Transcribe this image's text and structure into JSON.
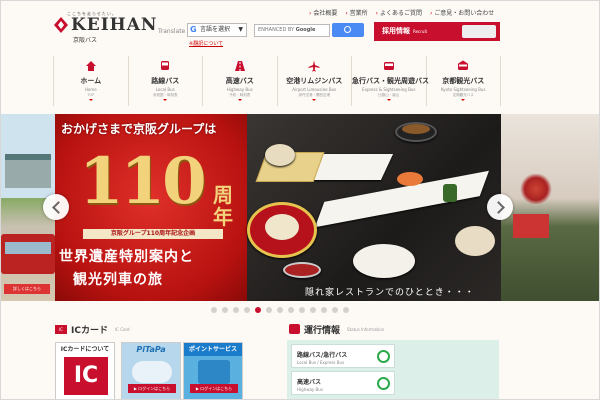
{
  "brand": {
    "kana": "ここちを走らせたい。",
    "name": "KEIHAN",
    "sub": "京阪バス"
  },
  "top_links": [
    "会社概要",
    "営業所",
    "よくあるご質問",
    "ご意見・お問い合わせ"
  ],
  "translate": {
    "label": "Translate",
    "select_value": "言語を選択",
    "note": "※翻訳について"
  },
  "search": {
    "placeholder_enhanced": "ENHANCED BY",
    "placeholder_google": "Google"
  },
  "recruit": {
    "label": "採用情報",
    "sub": "Recruit"
  },
  "nav": [
    {
      "label": "ホーム",
      "en": "Home",
      "small": "TOP",
      "icon": "home-icon"
    },
    {
      "label": "路線バス",
      "en": "Local Bus",
      "small": "系統図・時刻表",
      "icon": "bus-icon"
    },
    {
      "label": "高速バス",
      "en": "Highway Bus",
      "small": "予約・時刻表",
      "icon": "highway-icon"
    },
    {
      "label": "空港リムジンバス",
      "en": "Airport Limousine Bus",
      "small": "伊丹空港・関西空港",
      "icon": "airplane-icon"
    },
    {
      "label": "急行バス・観光周遊バス",
      "en": "Express & Sightseeing Bus",
      "small": "比叡山・嵐山",
      "icon": "express-bus-icon"
    },
    {
      "label": "京都観光バス",
      "en": "Kyoto Sightseeing Bus",
      "small": "定期観光バス",
      "icon": "kyoto-bus-icon"
    }
  ],
  "slider": {
    "left_button": "詳しくはこちら",
    "main_top": "おかげさまで京阪グループは",
    "main_number": "110",
    "main_suffix": "周年",
    "main_band": "京阪グループ110周年記念企画",
    "main_line1": "世界遺産特別案内と",
    "main_line2": "観光列車の旅",
    "food_caption": "隠れ家レストランでのひととき・・・",
    "dot_count": 13,
    "active_dot": 4
  },
  "ic": {
    "title": "ICカード",
    "en": "IC Card",
    "cards": [
      {
        "title": "ICカードについて",
        "big": "IC",
        "button": ""
      },
      {
        "title": "PiTaPa",
        "button": "▶ ログインはこちら"
      },
      {
        "title": "ポイントサービス",
        "button": "▶ ログインはこちら"
      }
    ]
  },
  "status": {
    "title": "運行情報",
    "en": "Status Information",
    "rows": [
      {
        "label": "路線バス/急行バス",
        "en": "Local Bus / Express Bus",
        "state": "normal"
      },
      {
        "label": "高速バス",
        "en": "Highway Bus",
        "state": "normal"
      }
    ]
  },
  "colors": {
    "brand_red": "#c8102e",
    "status_ok": "#2aa84a"
  }
}
